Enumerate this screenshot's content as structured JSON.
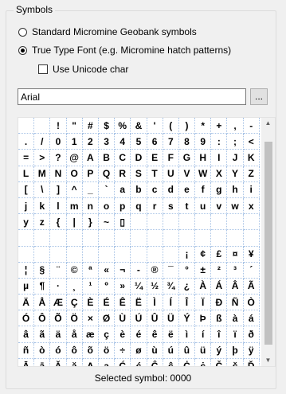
{
  "group": {
    "title": "Symbols"
  },
  "radios": [
    {
      "label": "Standard Micromine Geobank symbols",
      "checked": false
    },
    {
      "label": "True Type Font (e.g. Micromine hatch patterns)",
      "checked": true
    }
  ],
  "unicode_checkbox": {
    "label": "Use Unicode char",
    "checked": false
  },
  "font": {
    "value": "Arial"
  },
  "browse_button": {
    "label": "..."
  },
  "symbol_grid": {
    "columns": 15,
    "rows": [
      [
        "",
        " ",
        "!",
        "\"",
        "#",
        "$",
        "%",
        "&",
        "'",
        "(",
        ")",
        "*",
        "+",
        ",",
        "-"
      ],
      [
        ".",
        "/",
        "0",
        "1",
        "2",
        "3",
        "4",
        "5",
        "6",
        "7",
        "8",
        "9",
        ":",
        ";",
        "<"
      ],
      [
        "=",
        ">",
        "?",
        "@",
        "A",
        "B",
        "C",
        "D",
        "E",
        "F",
        "G",
        "H",
        "I",
        "J",
        "K"
      ],
      [
        "L",
        "M",
        "N",
        "O",
        "P",
        "Q",
        "R",
        "S",
        "T",
        "U",
        "V",
        "W",
        "X",
        "Y",
        "Z"
      ],
      [
        "[",
        "\\",
        "]",
        "^",
        "_",
        "`",
        "a",
        "b",
        "c",
        "d",
        "e",
        "f",
        "g",
        "h",
        "i"
      ],
      [
        "j",
        "k",
        "l",
        "m",
        "n",
        "o",
        "p",
        "q",
        "r",
        "s",
        "t",
        "u",
        "v",
        "w",
        "x"
      ],
      [
        "y",
        "z",
        "{",
        "|",
        "}",
        "~",
        "▯",
        "",
        "",
        "",
        "",
        "",
        "",
        "",
        ""
      ],
      [
        "",
        "",
        "",
        "",
        "",
        "",
        "",
        "",
        "",
        "",
        "",
        "",
        "",
        "",
        ""
      ],
      [
        "",
        "",
        "",
        "",
        "",
        "",
        "",
        "",
        "",
        "",
        "¡",
        "¢",
        "£",
        "¤",
        "¥"
      ],
      [
        "¦",
        "§",
        "¨",
        "©",
        "ª",
        "«",
        "¬",
        "-",
        "®",
        "¯",
        "°",
        "±",
        "²",
        "³",
        "´"
      ],
      [
        "µ",
        "¶",
        "·",
        "¸",
        "¹",
        "º",
        "»",
        "¼",
        "½",
        "¾",
        "¿",
        "À",
        "Á",
        "Â",
        "Ã"
      ],
      [
        "Ä",
        "Å",
        "Æ",
        "Ç",
        "È",
        "É",
        "Ê",
        "Ë",
        "Ì",
        "Í",
        "Î",
        "Ï",
        "Ð",
        "Ñ",
        "Ò"
      ],
      [
        "Ó",
        "Ô",
        "Õ",
        "Ö",
        "×",
        "Ø",
        "Ù",
        "Ú",
        "Û",
        "Ü",
        "Ý",
        "Þ",
        "ß",
        "à",
        "á"
      ],
      [
        "â",
        "ã",
        "ä",
        "å",
        "æ",
        "ç",
        "è",
        "é",
        "ê",
        "ë",
        "ì",
        "í",
        "î",
        "ï",
        "ð"
      ],
      [
        "ñ",
        "ò",
        "ó",
        "ô",
        "õ",
        "ö",
        "÷",
        "ø",
        "ù",
        "ú",
        "û",
        "ü",
        "ý",
        "þ",
        "ÿ"
      ],
      [
        "Ā",
        "ā",
        "Ă",
        "ă",
        "Ą",
        "ą",
        "Ć",
        "ć",
        "Ĉ",
        "ĉ",
        "Ċ",
        "ċ",
        "Č",
        "č",
        "Ď"
      ]
    ]
  },
  "status": {
    "text": "Selected symbol:  0000"
  }
}
